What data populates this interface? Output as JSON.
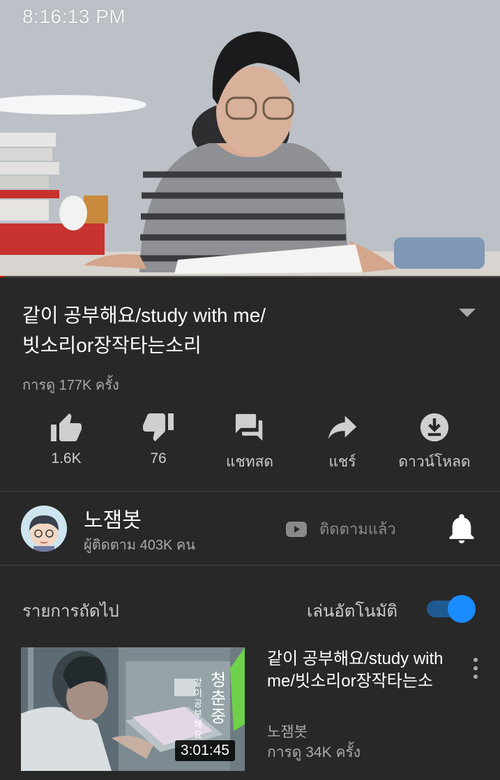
{
  "player": {
    "overlay_time": "8:16:13 PM",
    "progress_fraction": 0.008
  },
  "video": {
    "title_line1": "같이 공부해요/study with me/",
    "title_line2": "빗소리or장작타는소리",
    "views": "การดู 177K ครั้ง"
  },
  "actions": {
    "like_count": "1.6K",
    "dislike_count": "76",
    "chat_label": "แชทสด",
    "share_label": "แชร์",
    "download_label": "ดาวน์โหลด"
  },
  "channel": {
    "name": "노잼봇",
    "subscribers": "ผู้ติดตาม 403K คน",
    "subscribed_label": "ติดตามแล้ว"
  },
  "up_next": {
    "label": "รายการถัดไป",
    "autoplay_label": "เล่นอัตโนมัติ",
    "autoplay_on": true
  },
  "next_video": {
    "title": "같이 공부해요/study with me/빗소리or장작타는소",
    "channel": "노잼봇",
    "views": "การดู 34K ครั้ง",
    "duration": "3:01:45",
    "thumb_text_1": "청춘중",
    "thumb_text_2": "같이공부해요"
  },
  "colors": {
    "background": "#282828",
    "accent_blue": "#1a8cff",
    "progress_red": "#ff0000"
  }
}
